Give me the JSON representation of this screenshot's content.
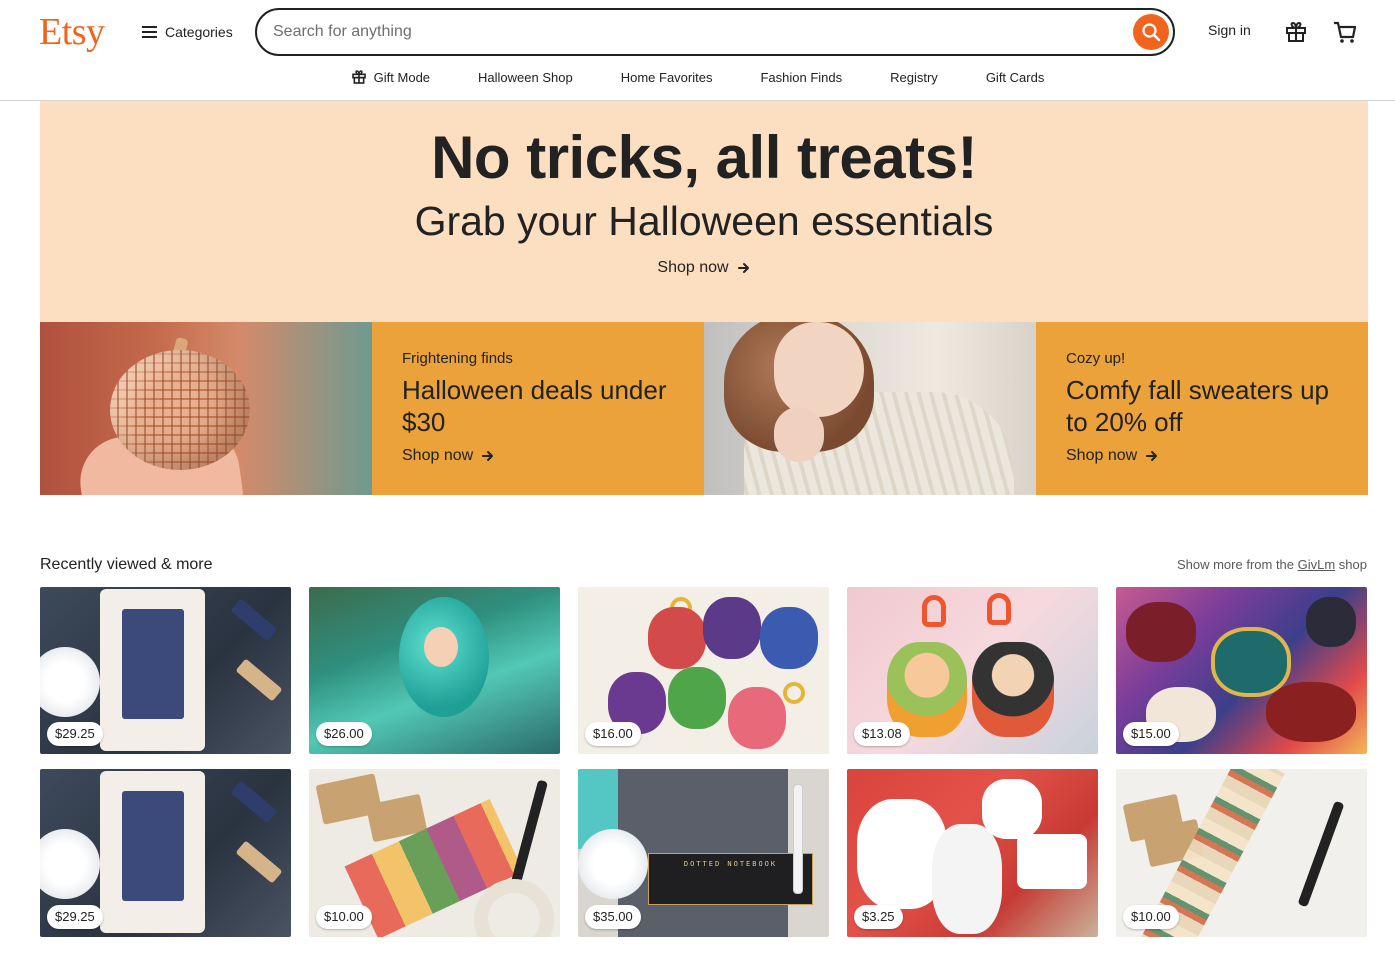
{
  "header": {
    "logo": "Etsy",
    "categories_label": "Categories",
    "search_placeholder": "Search for anything",
    "search_value": "",
    "signin_label": "Sign in"
  },
  "nav": {
    "items": [
      {
        "label": "Gift Mode",
        "icon": "gift-icon"
      },
      {
        "label": "Halloween Shop"
      },
      {
        "label": "Home Favorites"
      },
      {
        "label": "Fashion Finds"
      },
      {
        "label": "Registry"
      },
      {
        "label": "Gift Cards"
      }
    ]
  },
  "hero": {
    "title": "No tricks, all treats!",
    "subtitle": "Grab your Halloween essentials",
    "cta": "Shop now",
    "bg_color": "#fcdfc1"
  },
  "promos": [
    {
      "kicker": "Frightening finds",
      "headline": "Halloween deals under $30",
      "cta": "Shop now"
    },
    {
      "kicker": "Cozy up!",
      "headline": "Comfy fall sweaters up to 20% off",
      "cta": "Shop now"
    }
  ],
  "recent": {
    "title": "Recently viewed & more",
    "more_prefix": "Show more from the ",
    "shop_name": "GivLm",
    "more_suffix": " shop",
    "prices": [
      "$29.25",
      "$26.00",
      "$16.00",
      "$13.08",
      "$15.00",
      "$29.25",
      "$10.00",
      "$35.00",
      "$3.25",
      "$10.00"
    ],
    "notebook_label": "DOTTED NOTEBOOK"
  },
  "colors": {
    "brand": "#f1641e",
    "promo": "#eba23a",
    "text": "#222222"
  }
}
